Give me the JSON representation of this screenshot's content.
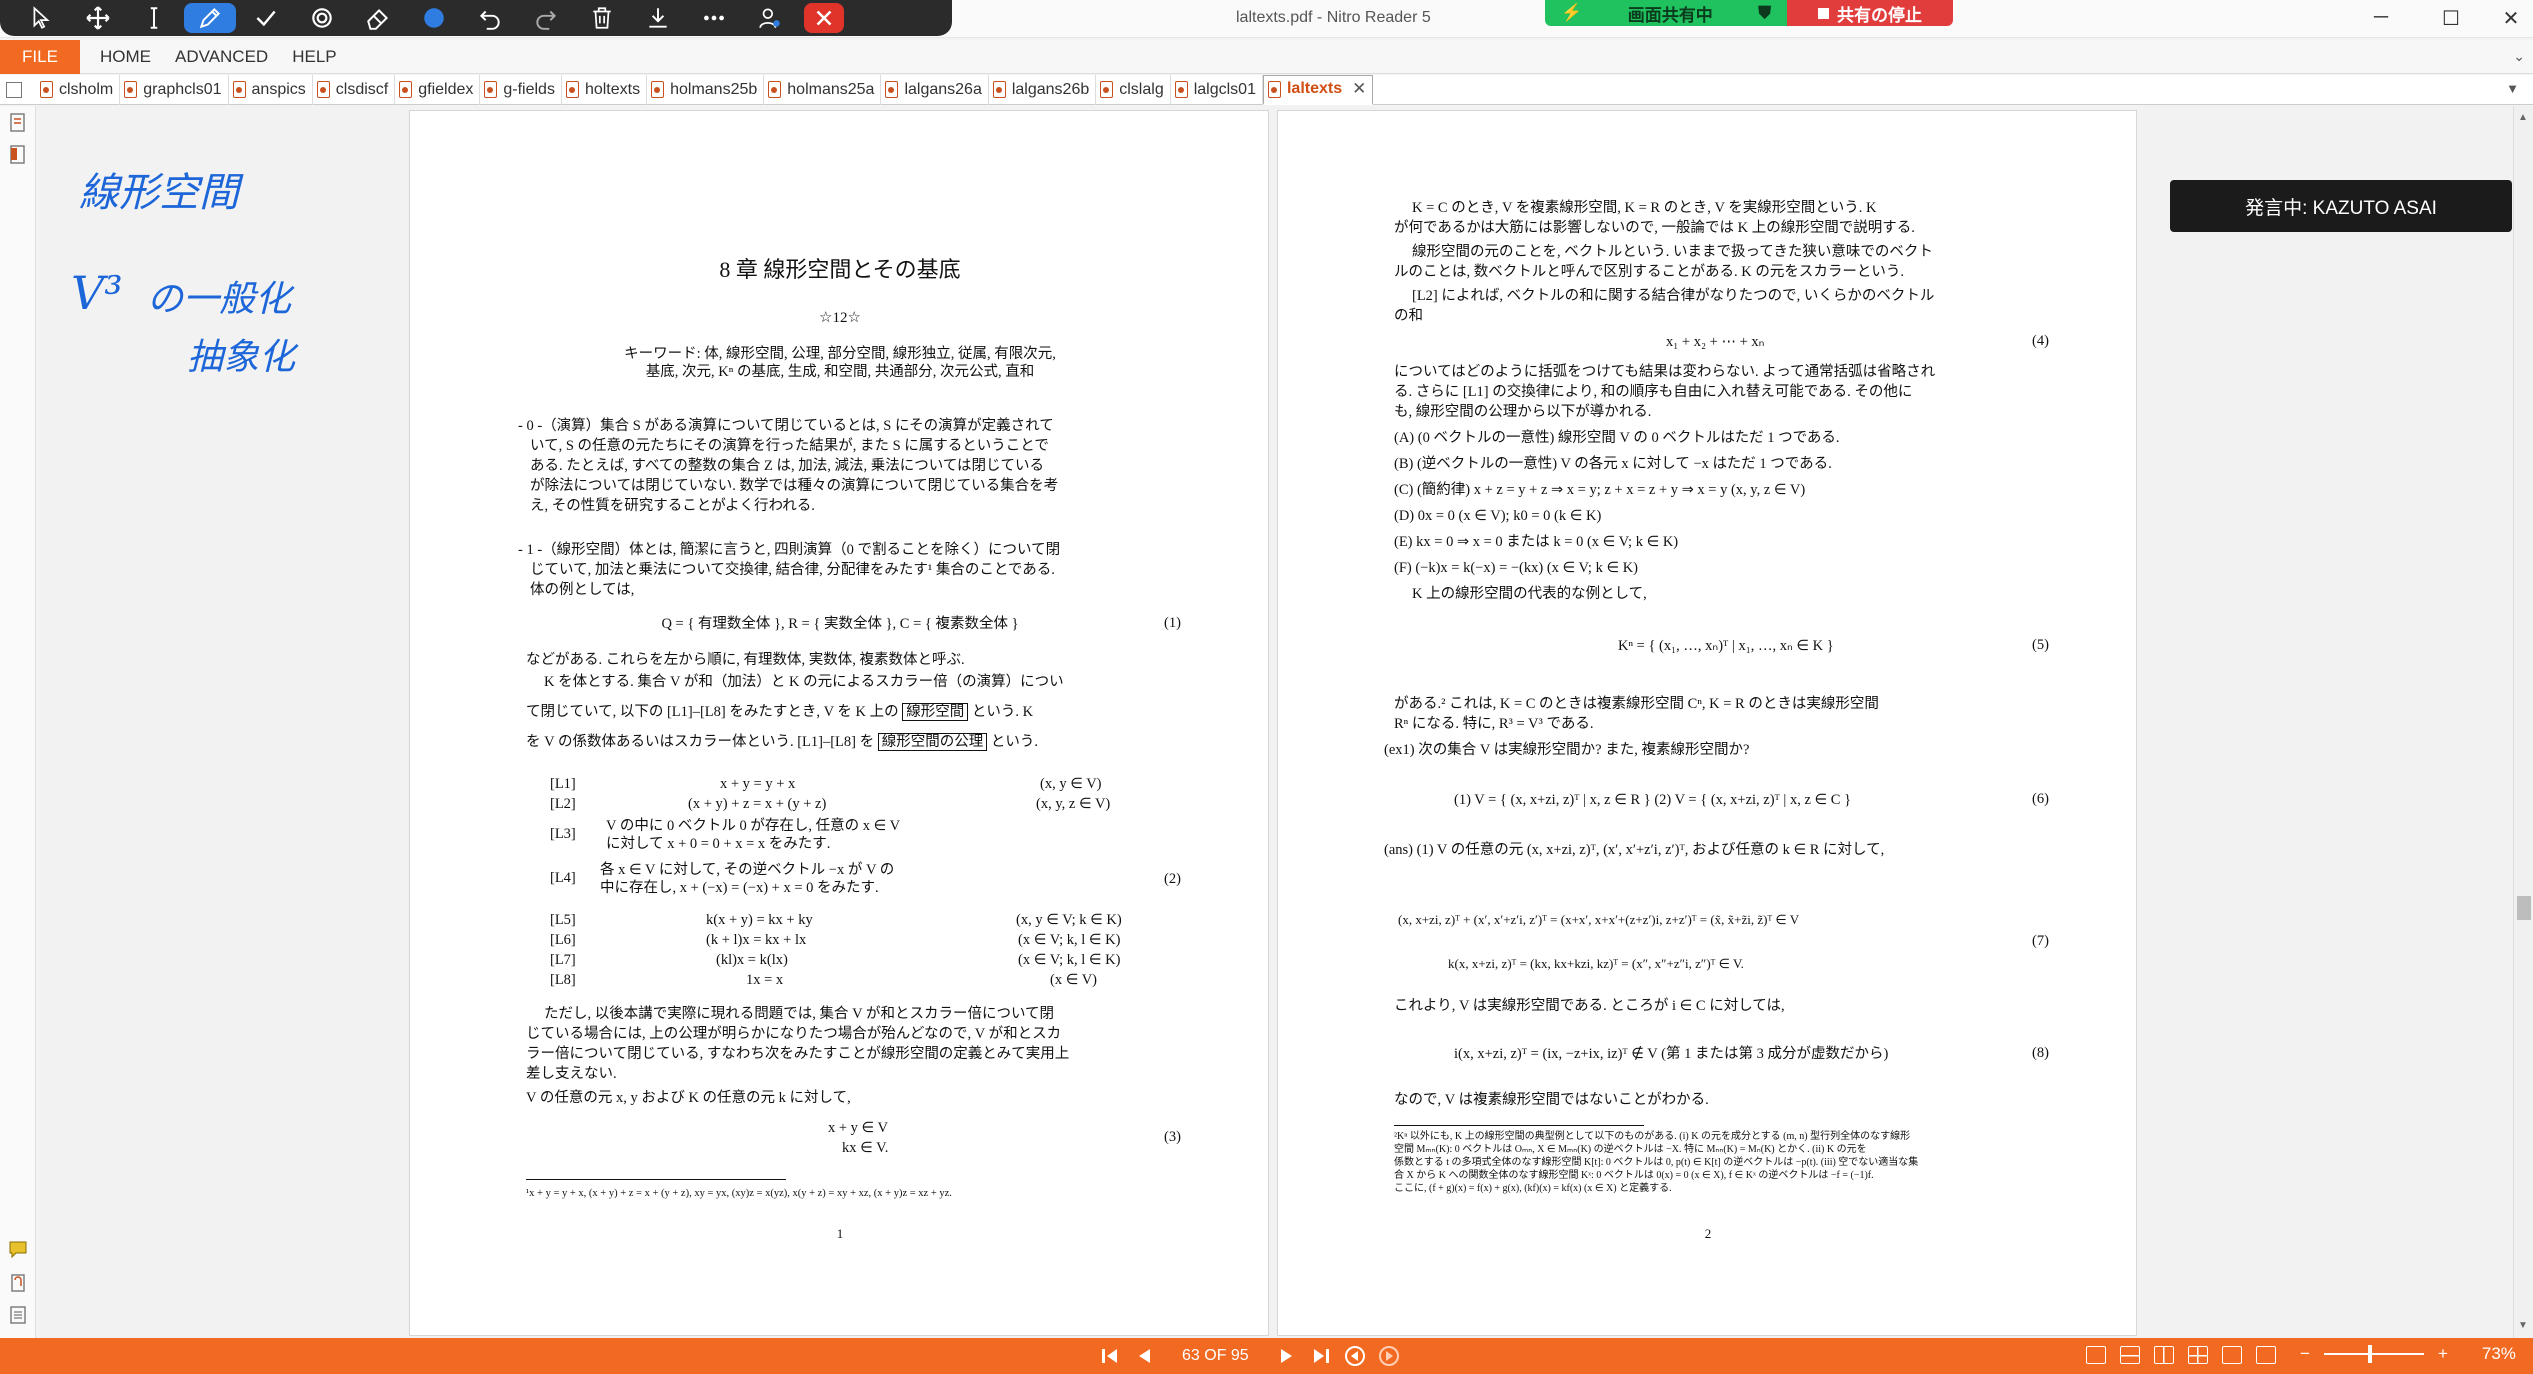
{
  "window": {
    "title": "laltexts.pdf - Nitro Reader 5"
  },
  "share": {
    "active_label": "画面共有中",
    "stop_label": "共有の停止"
  },
  "menu": {
    "file": "FILE",
    "home": "HOME",
    "advanced": "ADVANCED",
    "help": "HELP"
  },
  "tabs": [
    "clsholm",
    "graphcls01",
    "anspics",
    "clsdiscf",
    "gfieldex",
    "g-fields",
    "holtexts",
    "holmans25b",
    "holmans25a",
    "lalgans26a",
    "lalgans26b",
    "clslalg",
    "lalgcls01",
    "laltexts"
  ],
  "active_tab": "laltexts",
  "handwriting": {
    "line1": "線形空間",
    "line2a": "V³",
    "line2b": "の一般化",
    "line3": "抽象化"
  },
  "speaker": "発言中: KAZUTO ASAI",
  "status": {
    "page_indicator": "63 OF 95",
    "zoom": "73%"
  },
  "page1": {
    "title": "8 章  線形空間とその基底",
    "stars": "☆12☆",
    "keywords1": "キーワード: 体, 線形空間, 公理, 部分空間, 線形独立, 従属, 有限次元,",
    "keywords2": "基底, 次元, Kⁿ の基底, 生成, 和空間, 共通部分, 次元公式, 直和",
    "s0_1": "- 0 -（演算）集合 S がある演算について閉じているとは, S にその演算が定義されて",
    "s0_2": "いて, S の任意の元たちにその演算を行った結果が, また S に属するということで",
    "s0_3": "ある. たとえば, すべての整数の集合 Z は, 加法, 減法, 乗法については閉じている",
    "s0_4": "が除法については閉じていない. 数学では種々の演算について閉じている集合を考",
    "s0_5": "え, その性質を研究することがよく行われる.",
    "s1_1": "- 1 -（線形空間）体とは, 簡潔に言うと, 四則演算（0 で割ることを除く）について閉",
    "s1_2": "じていて, 加法と乗法について交換律, 結合律, 分配律をみたす¹ 集合のことである.",
    "s1_3": "体の例としては,",
    "eq1": "Q = { 有理数全体 },  R = { 実数全体 },  C = { 複素数全体 }",
    "eq1_no": "(1)",
    "p1": "などがある. これらを左から順に, 有理数体, 実数体, 複素数体と呼ぶ.",
    "p2_1": "K を体とする. 集合 V が和（加法）と K の元によるスカラー倍（の演算）につい",
    "p2_2a": "て閉じていて, 以下の [L1]–[L8] をみたすとき, V を K 上の",
    "p2_2box": "線形空間",
    "p2_2b": "という. K",
    "p2_3a": "を V の係数体あるいはスカラー体という. [L1]–[L8] を",
    "p2_3box": "線形空間の公理",
    "p2_3b": "という.",
    "axioms": [
      {
        "tag": "[L1]",
        "eq": "x + y = y + x",
        "cond": "(x, y ∈ V)"
      },
      {
        "tag": "[L2]",
        "eq": "(x + y) + z = x + (y + z)",
        "cond": "(x, y, z ∈ V)"
      },
      {
        "tag": "[L3]",
        "eq": "V の中に 0 ベクトル 0 が存在し, 任意の x ∈ V",
        "cond": ""
      },
      {
        "tag": "",
        "eq": "に対して x + 0 = 0 + x = x をみたす.",
        "cond": ""
      },
      {
        "tag": "[L4]",
        "eq": "各 x ∈ V に対して, その逆ベクトル −x が V の",
        "cond": ""
      },
      {
        "tag": "",
        "eq": "中に存在し, x + (−x) = (−x) + x = 0 をみたす.",
        "cond": ""
      },
      {
        "tag": "[L5]",
        "eq": "k(x + y) = kx + ky",
        "cond": "(x, y ∈ V; k ∈ K)"
      },
      {
        "tag": "[L6]",
        "eq": "(k + l)x = kx + lx",
        "cond": "(x ∈ V; k, l ∈ K)"
      },
      {
        "tag": "[L7]",
        "eq": "(kl)x = k(lx)",
        "cond": "(x ∈ V; k, l ∈ K)"
      },
      {
        "tag": "[L8]",
        "eq": "1x = x",
        "cond": "(x ∈ V)"
      }
    ],
    "eq2_no": "(2)",
    "p3_1": "ただし, 以後本講で実際に現れる問題では, 集合 V が和とスカラー倍について閉",
    "p3_2": "じている場合には, 上の公理が明らかになりたつ場合が殆んどなので, V が和とスカ",
    "p3_3": "ラー倍について閉じている, すなわち次をみたすことが線形空間の定義とみて実用上",
    "p3_4": "差し支えない.",
    "p4": "V の任意の元 x, y および K の任意の元 k に対して,",
    "eq3a": "x + y  ∈ V",
    "eq3b": "kx  ∈ V.",
    "eq3_no": "(3)",
    "footnote": "¹x + y = y + x, (x + y) + z = x + (y + z), xy = yx, (xy)z = x(yz), x(y + z) = xy + xz, (x + y)z = xz + yz.",
    "page_no": "1"
  },
  "page2": {
    "l1": "K = C のとき, V を複素線形空間, K = R のとき, V を実線形空間という. K",
    "l2": "が何であるかは大筋には影響しないので, 一般論では K 上の線形空間で説明する.",
    "l3": "線形空間の元のことを, ベクトルという. いままで扱ってきた狭い意味でのベクト",
    "l4": "ルのことは, 数ベクトルと呼んで区別することがある. K の元をスカラーという.",
    "l5": "[L2] によれば, ベクトルの和に関する結合律がなりたつので, いくらかのベクトル",
    "l6": "の和",
    "eq4": "x₁ + x₂ + ⋯ + xₙ",
    "eq4_no": "(4)",
    "l7": "についてはどのように括弧をつけても結果は変わらない. よって通常括弧は省略され",
    "l8": "る. さらに [L1] の交換律により, 和の順序も自由に入れ替え可能である. その他に",
    "l9": "も, 線形空間の公理から以下が導かれる.",
    "props": [
      "(A)  (0 ベクトルの一意性)  線形空間 V の 0 ベクトルはただ 1 つである.",
      "(B)  (逆ベクトルの一意性)  V の各元 x に対して −x はただ 1 つである.",
      "(C)  (簡約律)   x + z = y + z ⇒ x = y;   z + x = z + y ⇒ x = y    (x, y, z ∈ V)",
      "(D)  0x = 0   (x ∈ V);       k0 = 0   (k ∈ K)",
      "(E)  kx = 0 ⇒ x = 0 または k = 0       (x ∈ V; k ∈ K)",
      "(F)  (−k)x = k(−x) = −(kx)       (x ∈ V; k ∈ K)"
    ],
    "l10": "K 上の線形空間の代表的な例として,",
    "eq5": "Kⁿ = { (x₁, …, xₙ)ᵀ | x₁, …, xₙ ∈ K }",
    "eq5_no": "(5)",
    "l11": "がある.² これは, K = C のときは複素線形空間 Cⁿ, K = R のときは実線形空間",
    "l12": "Rⁿ になる. 特に, R³ = V³ である.",
    "ex1": "(ex1) 次の集合 V は実線形空間か? また, 複素線形空間か?",
    "eq6": "(1) V = { (x, x+zi, z)ᵀ | x, z ∈ R }      (2) V = { (x, x+zi, z)ᵀ | x, z ∈ C }",
    "eq6_no": "(6)",
    "ans": "(ans) (1) V の任意の元 (x, x+zi, z)ᵀ, (x′, x′+z′i, z′)ᵀ, および任意の k ∈ R に対して,",
    "eq7a": "(x, x+zi, z)ᵀ + (x′, x′+z′i, z′)ᵀ = (x+x′, x+x′+(z+z′)i, z+z′)ᵀ = (x̃, x̃+z̃i, z̃)ᵀ ∈ V",
    "eq7b": "k(x, x+zi, z)ᵀ = (kx, kx+kzi, kz)ᵀ = (x″, x″+z″i, z″)ᵀ ∈ V.",
    "eq7_no": "(7)",
    "l13": "これより, V は実線形空間である. ところが i ∈ C に対しては,",
    "eq8": "i(x, x+zi, z)ᵀ = (ix, −z+ix, iz)ᵀ ∉ V      (第 1 または第 3 成分が虚数だから)",
    "eq8_no": "(8)",
    "l14": "なので, V は複素線形空間ではないことがわかる.",
    "fn1": "²Kⁿ 以外にも, K 上の線形空間の典型例として以下のものがある. (i) K の元を成分とする (m, n) 型行列全体のなす線形",
    "fn2": "空間 Mₘₙ(K): 0 ベクトルは Oₘₙ, X ∈ Mₘₙ(K) の逆ベクトルは −X. 特に Mₙₙ(K) = Mₙ(K) とかく. (ii) K の元を",
    "fn3": "係数とする t の多項式全体のなす線形空間 K[t]: 0 ベクトルは 0, p(t) ∈ K[t] の逆ベクトルは −p(t). (iii) 空でない適当な集",
    "fn4": "合 X から K への関数全体のなす線形空間 Kˣ: 0 ベクトルは 0(x) = 0 (x ∈ X), f ∈ Kˣ の逆ベクトルは −f = (−1)f.",
    "fn5": "ここに, (f + g)(x) = f(x) + g(x), (kf)(x) = kf(x) (x ∈ X) と定義する.",
    "page_no": "2"
  },
  "colors": {
    "accent": "#f26a22",
    "pen": "#1c66d9",
    "share_green": "#1fc25f",
    "share_red": "#e23d3d"
  }
}
